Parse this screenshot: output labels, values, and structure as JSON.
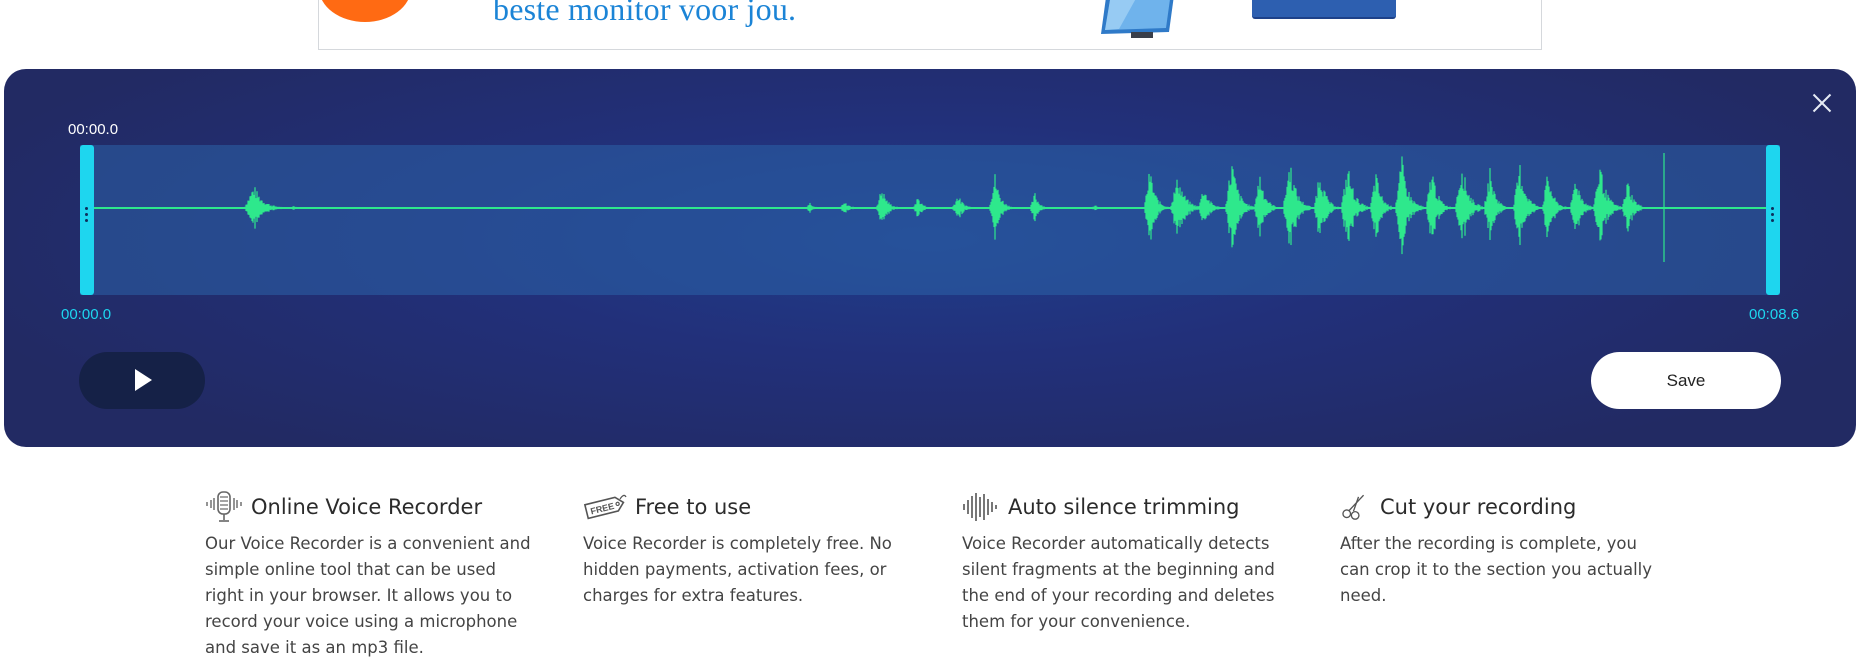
{
  "ad": {
    "text": "beste monitor voor jou."
  },
  "recorder": {
    "close_icon": "close-icon",
    "time_current": "00:00.0",
    "trim_start": "00:00.0",
    "trim_end": "00:08.6",
    "play_icon": "play-icon",
    "save_label": "Save",
    "colors": {
      "background": "#222a63",
      "waveform": "#2ee88c",
      "handle": "#1ed6ef"
    }
  },
  "features": [
    {
      "icon": "microphone-icon",
      "title": "Online Voice Recorder",
      "text": "Our Voice Recorder is a convenient and simple online tool that can be used right in your browser. It allows you to record your voice using a microphone and save it as an mp3 file."
    },
    {
      "icon": "free-tag-icon",
      "icon_text": "FREE",
      "title": "Free to use",
      "text": "Voice Recorder is completely free. No hidden payments, activation fees, or charges for extra features."
    },
    {
      "icon": "soundwave-icon",
      "title": "Auto silence trimming",
      "text": "Voice Recorder automatically detects silent fragments at the beginning and the end of your recording and deletes them for your convenience."
    },
    {
      "icon": "scissors-icon",
      "title": "Cut your recording",
      "text": "After the recording is complete, you can crop it to the section you actually need."
    }
  ]
}
